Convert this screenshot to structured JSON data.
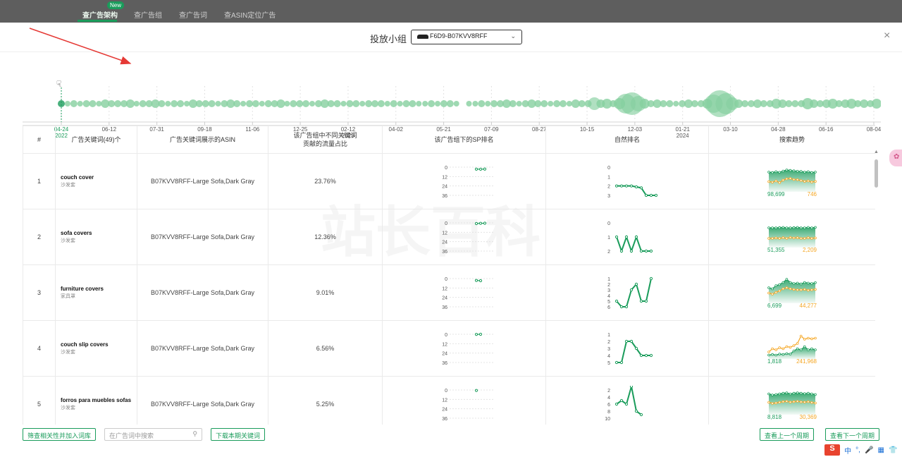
{
  "bg_tabs": [
    "查广告架构",
    "查广告组",
    "查广告词",
    "查ASIN定位广告"
  ],
  "bg_tab_badge": "New",
  "modal": {
    "title": "投放小组",
    "group_selected": "F6D9-B07KVV8RFF"
  },
  "timeline": {
    "ticks": [
      {
        "label": "04-24",
        "year": "2022",
        "active": true
      },
      {
        "label": "06-12"
      },
      {
        "label": "07-31"
      },
      {
        "label": "09-18"
      },
      {
        "label": "11-06"
      },
      {
        "label": "12-25"
      },
      {
        "label": "02-12",
        "year": "2023"
      },
      {
        "label": "04-02"
      },
      {
        "label": "05-21"
      },
      {
        "label": "07-09"
      },
      {
        "label": "08-27"
      },
      {
        "label": "10-15"
      },
      {
        "label": "12-03"
      },
      {
        "label": "01-21",
        "year": "2024"
      },
      {
        "label": "03-10"
      },
      {
        "label": "04-28"
      },
      {
        "label": "06-16"
      },
      {
        "label": "08-04"
      }
    ],
    "bubble_sizes": [
      5,
      4,
      5,
      4,
      5,
      5,
      4,
      6,
      5,
      5,
      5,
      6,
      4,
      5,
      5,
      6,
      5,
      4,
      5,
      5,
      4,
      6,
      5,
      5,
      5,
      4,
      5,
      6,
      5,
      4,
      5,
      5,
      4,
      5,
      5,
      6,
      4,
      5,
      5,
      5,
      4,
      5,
      6,
      5,
      5,
      4,
      5,
      5,
      4,
      5,
      5,
      5,
      4,
      5,
      4,
      5,
      5,
      4,
      4,
      5,
      4,
      5,
      5,
      4,
      0,
      4,
      4,
      5,
      4,
      5,
      5,
      6,
      5,
      4,
      5,
      6,
      5,
      5,
      4,
      5,
      5,
      4,
      6,
      5,
      5,
      9,
      6,
      7,
      5,
      8,
      14,
      16,
      11,
      7,
      5,
      6,
      5,
      5,
      4,
      5,
      6,
      5,
      5,
      7,
      13,
      19,
      15,
      9,
      6,
      5,
      5,
      6,
      5,
      5,
      7,
      6,
      5,
      5,
      5,
      8,
      6,
      5,
      6,
      7,
      5,
      6,
      7,
      5,
      6,
      5,
      7
    ]
  },
  "table": {
    "headers": [
      "#",
      "广告关键词(49)个",
      "广告关键词展示的ASIN",
      "该广告组中不同关键词\n贡献的流量占比",
      "该广告组下的SP排名",
      "自然排名",
      "搜索趋势"
    ],
    "rows": [
      {
        "no": "1",
        "kw": "couch cover",
        "kw_cn": "沙发套",
        "asin": "B07KVV8RFF-Large Sofa,Dark Gray",
        "share": "23.76%",
        "sp_ticks": [
          "0",
          "12",
          "24",
          "36"
        ],
        "sp_points": [
          0.85,
          0.88,
          0.82
        ],
        "org_ticks": [
          "0",
          "1",
          "2",
          "3"
        ],
        "org_points": [
          2,
          2,
          2,
          2,
          2.1,
          2.2,
          3,
          3,
          3
        ],
        "trend_green_val": "98,699",
        "trend_orange_val": "746",
        "trend_green": [
          0.8,
          0.78,
          0.82,
          0.79,
          0.85,
          0.9,
          0.88,
          0.86,
          0.84,
          0.83,
          0.8,
          0.82,
          0.78,
          0.8
        ],
        "trend_orange": [
          0.35,
          0.32,
          0.38,
          0.3,
          0.42,
          0.48,
          0.5,
          0.45,
          0.44,
          0.4,
          0.36,
          0.38,
          0.33,
          0.36
        ]
      },
      {
        "no": "2",
        "kw": "sofa covers",
        "kw_cn": "沙发套",
        "asin": "B07KVV8RFF-Large Sofa,Dark Gray",
        "share": "12.36%",
        "sp_ticks": [
          "0",
          "12",
          "24",
          "36"
        ],
        "sp_points": [
          0.3,
          0.2,
          0.15
        ],
        "org_ticks": [
          "0",
          "1",
          "2"
        ],
        "org_points": [
          1,
          2,
          1,
          2,
          1,
          2,
          2,
          2
        ],
        "trend_green_val": "51,355",
        "trend_orange_val": "2,209",
        "trend_green": [
          0.8,
          0.8,
          0.8,
          0.81,
          0.82,
          0.8,
          0.8,
          0.81,
          0.82,
          0.8,
          0.8,
          0.82,
          0.8,
          0.82
        ],
        "trend_orange": [
          0.3,
          0.3,
          0.32,
          0.3,
          0.33,
          0.3,
          0.34,
          0.32,
          0.33,
          0.3,
          0.3,
          0.33,
          0.3,
          0.32
        ]
      },
      {
        "no": "3",
        "kw": "furniture covers",
        "kw_cn": "家具罩",
        "asin": "B07KVV8RFF-Large Sofa,Dark Gray",
        "share": "9.01%",
        "sp_ticks": [
          "0",
          "12",
          "24",
          "36"
        ],
        "sp_points": [
          0.8,
          0.9
        ],
        "org_ticks": [
          "1",
          "2",
          "3",
          "4",
          "5",
          "6"
        ],
        "org_points": [
          5,
          6,
          6,
          3,
          2,
          5,
          5,
          1
        ],
        "trend_green_val": "6,699",
        "trend_orange_val": "44,277",
        "trend_green": [
          0.6,
          0.55,
          0.7,
          0.75,
          0.85,
          1.0,
          0.85,
          0.8,
          0.82,
          0.78,
          0.85,
          0.82,
          0.8,
          0.84
        ],
        "trend_orange": [
          0.35,
          0.3,
          0.38,
          0.45,
          0.55,
          0.6,
          0.55,
          0.52,
          0.5,
          0.5,
          0.52,
          0.48,
          0.5,
          0.52
        ]
      },
      {
        "no": "4",
        "kw": "couch slip covers",
        "kw_cn": "沙发套",
        "asin": "B07KVV8RFF-Large Sofa,Dark Gray",
        "share": "6.56%",
        "sp_ticks": [
          "0",
          "12",
          "24",
          "36"
        ],
        "sp_points": [
          0.05,
          0.0
        ],
        "org_ticks": [
          "1",
          "2",
          "3",
          "4",
          "5"
        ],
        "org_points": [
          5,
          5,
          2,
          2,
          3,
          4,
          4,
          4
        ],
        "trend_green_val": "1,818",
        "trend_orange_val": "241,968",
        "trend_green": [
          0.05,
          0.08,
          0.05,
          0.1,
          0.08,
          0.12,
          0.1,
          0.25,
          0.35,
          0.3,
          0.45,
          0.3,
          0.35,
          0.3
        ],
        "trend_orange": [
          0.2,
          0.35,
          0.3,
          0.4,
          0.35,
          0.45,
          0.42,
          0.5,
          0.6,
          0.95,
          0.8,
          0.85,
          0.82,
          0.85
        ]
      },
      {
        "no": "5",
        "kw": "forros para muebles sofas",
        "kw_cn": "沙发套",
        "asin": "B07KVV8RFF-Large Sofa,Dark Gray",
        "share": "5.25%",
        "sp_ticks": [
          "0",
          "12",
          "24",
          "36"
        ],
        "sp_points": [
          0.2
        ],
        "org_ticks": [
          "2",
          "4",
          "6",
          "8",
          "10"
        ],
        "org_points": [
          6,
          5,
          6,
          1,
          8,
          9
        ],
        "trend_green_val": "8,818",
        "trend_orange_val": "30,369",
        "trend_green": [
          0.85,
          0.8,
          0.82,
          0.85,
          0.88,
          0.9,
          0.85,
          0.88,
          0.9,
          0.88,
          0.86,
          0.88,
          0.85,
          0.82
        ],
        "trend_orange": [
          0.45,
          0.4,
          0.42,
          0.45,
          0.48,
          0.5,
          0.46,
          0.48,
          0.5,
          0.47,
          0.46,
          0.48,
          0.44,
          0.42
        ]
      }
    ]
  },
  "footer": {
    "filter_btn": "筛查相关性并加入词库",
    "search_placeholder": "在广告词中搜索",
    "download_btn": "下载本期关键词",
    "prev_btn": "查看上一个周期",
    "next_btn": "查看下一个周期"
  },
  "ime": {
    "logo": "S",
    "items": [
      "中",
      "°,",
      "🎤",
      "▦",
      "👕"
    ]
  },
  "colors": {
    "green": "#1a9c5b",
    "orange": "#f5a623",
    "bubble": "#86cf9f"
  }
}
